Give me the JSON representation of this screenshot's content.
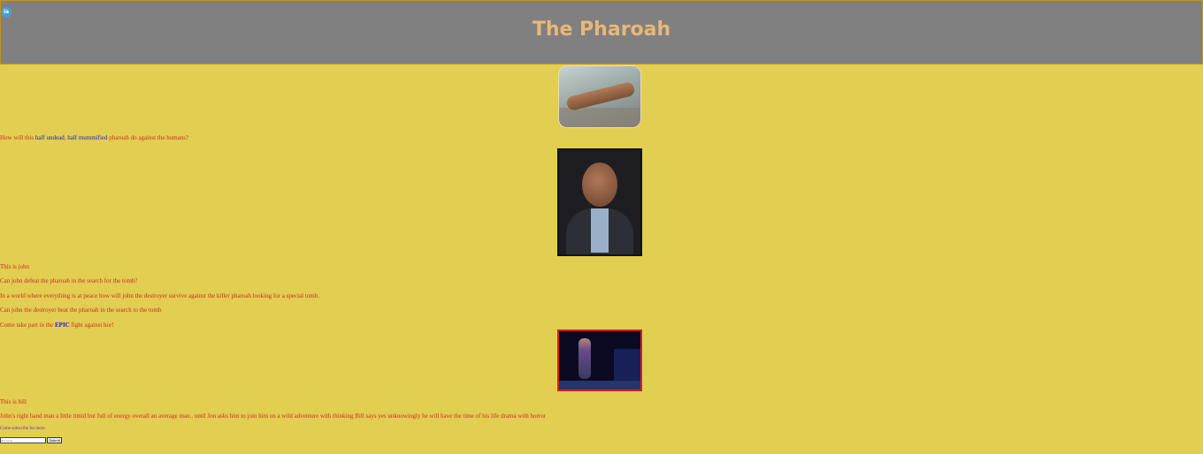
{
  "header": {
    "logo_text": "ia",
    "title": "The Pharoah"
  },
  "line1": {
    "a": "How will this ",
    "b": "half undead",
    "c": ", ",
    "d": "half mummified",
    "e": " pharoah do against the humans?"
  },
  "caption_john": "This is john",
  "q1": "Can john defeat the pharoah in the search for the tomb?",
  "q2": "In a world where everything is at peace how will john the destroyer survive against the killer pharoah looking for a special tomb.",
  "q3": "Can john the destroyer beat the pharoah in the search to the tomb",
  "cta": {
    "a": "Come take part in the ",
    "b": "EPIC",
    "c": " fight against hor!"
  },
  "caption_bill": "This is bill",
  "bill_desc": "John's right hand man a little timid but full of energy overall an average man.. until Jon asks him to join him on a wild adventure with thinking Bill says yes unknowingly he will have the time of his life drama with horror",
  "subscribe": {
    "label": "Come subscribe for more",
    "placeholder": "first name",
    "button": "Submit"
  }
}
